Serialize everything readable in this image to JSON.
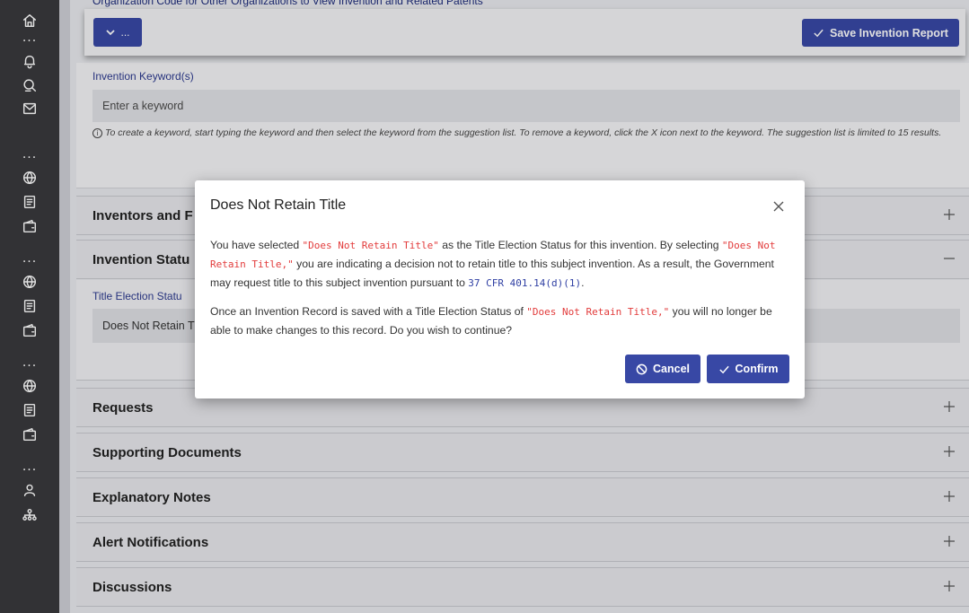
{
  "rail": {
    "icons": [
      "home-icon",
      "bell-icon",
      "search-person-icon",
      "mail-icon",
      "globe-icon",
      "document-icon",
      "wallet-icon",
      "globe-icon",
      "document-icon",
      "wallet-icon",
      "globe-icon",
      "document-icon",
      "wallet-icon",
      "user-icon",
      "org-chart-icon"
    ],
    "dots": "..."
  },
  "page": {
    "clipped_label": "Organization Code for Other Organizations to View Invention and Related Patents"
  },
  "toolbar": {
    "menu_label": "...",
    "save_label": "Save Invention Report"
  },
  "keywords": {
    "label": "Invention Keyword(s)",
    "placeholder": "Enter a keyword",
    "help": "To create a keyword, start typing the keyword and then select the keyword from the suggestion list. To remove a keyword, click the X icon next to the keyword. The suggestion list is limited to 15 results."
  },
  "sections": {
    "inventors": "Inventors and F",
    "status": "Invention Statu",
    "requests": "Requests",
    "supporting_documents": "Supporting Documents",
    "explanatory_notes": "Explanatory Notes",
    "alert_notifications": "Alert Notifications",
    "discussions": "Discussions"
  },
  "status_body": {
    "label": "Title Election Statu",
    "value": "Does Not Retain T"
  },
  "modal": {
    "title": "Does Not Retain Title",
    "p1_a": "You have selected ",
    "p1_code1": "\"Does Not Retain Title\"",
    "p1_b": " as the Title Election Status for this invention. By selecting ",
    "p1_code2": "\"Does Not Retain Title,\"",
    "p1_c": " you are indicating a decision not to retain title to this subject invention. As a result, the Government may request title to this subject invention pursuant to ",
    "p1_code3": "37 CFR 401.14(d)(1)",
    "p1_d": ".",
    "p2_a": "Once an Invention Record is saved with a Title Election Status of ",
    "p2_code": "\"Does Not Retain Title,\"",
    "p2_b": " you will no longer be able to make changes to this record. Do you wish to continue?",
    "cancel_label": "Cancel",
    "confirm_label": "Confirm"
  },
  "colors": {
    "primary": "#3848a5",
    "rail": "#3a3a3d",
    "code_red": "#e23b3b",
    "code_blue": "#2f3fa3"
  }
}
